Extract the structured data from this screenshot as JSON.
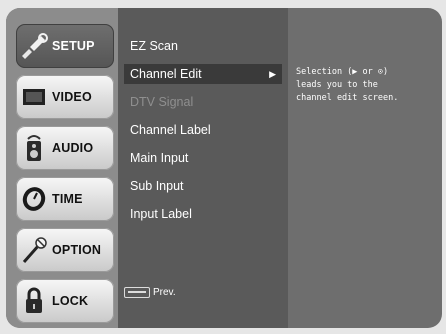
{
  "menu": {
    "tabs": [
      {
        "label": "SETUP",
        "icon": "setup-icon"
      },
      {
        "label": "VIDEO",
        "icon": "video-icon"
      },
      {
        "label": "AUDIO",
        "icon": "audio-icon"
      },
      {
        "label": "TIME",
        "icon": "time-icon"
      },
      {
        "label": "OPTION",
        "icon": "option-icon"
      },
      {
        "label": "LOCK",
        "icon": "lock-icon"
      }
    ],
    "active_tab": "SETUP",
    "items": [
      {
        "label": "EZ Scan"
      },
      {
        "label": "Channel Edit",
        "selected": true,
        "arrow": "▶"
      },
      {
        "label": "DTV Signal",
        "disabled": true
      },
      {
        "label": "Channel Label"
      },
      {
        "label": "Main Input"
      },
      {
        "label": "Sub Input"
      },
      {
        "label": "Input Label"
      }
    ],
    "description": "Selection (▶ or ⊙)\nleads you to the\nchannel edit screen.",
    "prev_label": "Prev."
  },
  "colors": {
    "background": "#e6e6e6",
    "frame": "#6e6e6e",
    "tab_column": "#8c8c8c",
    "menu_panel": "#5a5a5a",
    "selected_item": "#3a3a3a",
    "active_tab": "#5f5f5f",
    "disabled_text": "#8f8f8f"
  }
}
